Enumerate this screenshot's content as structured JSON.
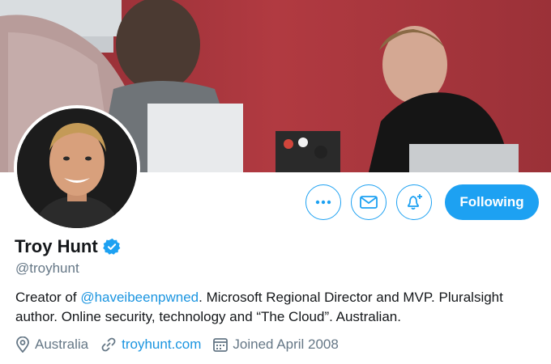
{
  "profile": {
    "name": "Troy Hunt",
    "handle": "@troyhunt",
    "bio_prefix": "Creator of ",
    "bio_mention": "@haveibeenpwned",
    "bio_line1_rest": ". Microsoft Regional Director and MVP. Pluralsight",
    "bio_line2": "author. Online security, technology and “The Cloud”. Australian.",
    "location": "Australia",
    "website": "troyhunt.com",
    "joined": "Joined April 2008"
  },
  "actions": {
    "following_label": "Following"
  },
  "icons": {
    "more": "more-icon",
    "message": "envelope-icon",
    "notify": "bell-plus-icon",
    "verified": "verified-badge-icon",
    "location": "location-pin-icon",
    "link": "link-icon",
    "calendar": "calendar-icon"
  },
  "colors": {
    "accent": "#1da1f2",
    "link": "#1b95e0",
    "secondary_text": "#657786",
    "banner_wall": "#a8343b"
  }
}
